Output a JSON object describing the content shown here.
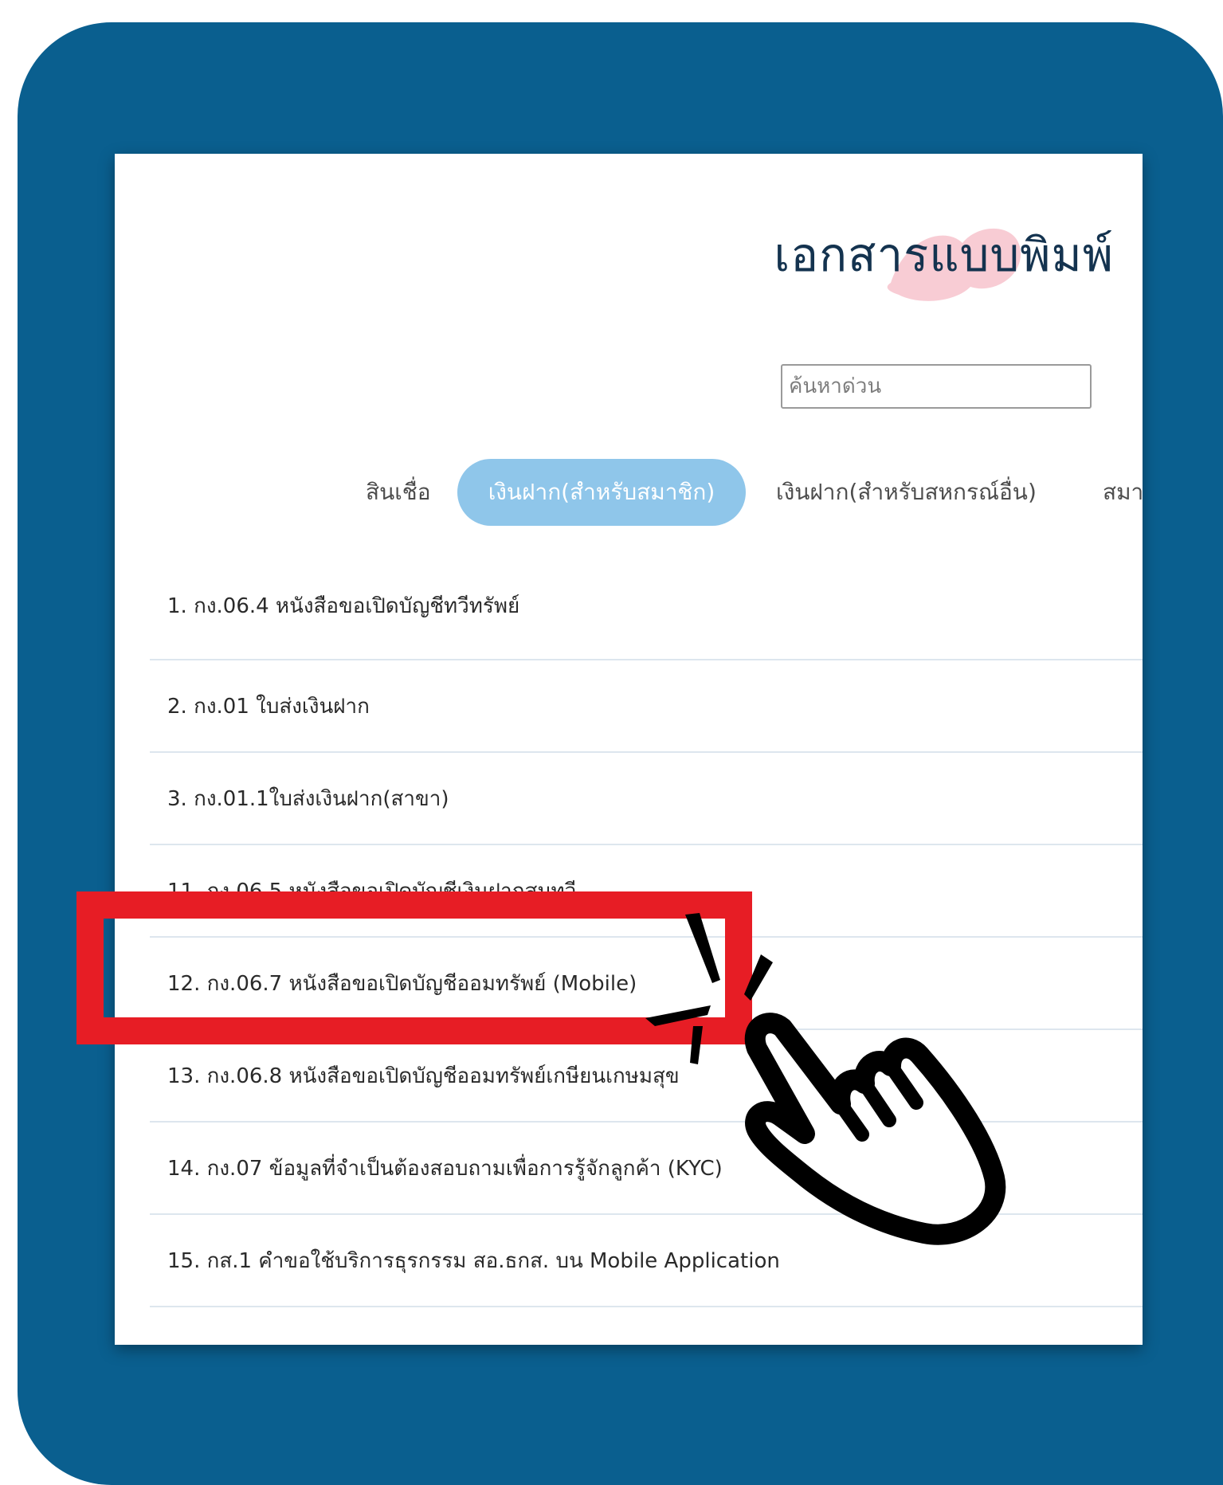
{
  "page": {
    "title": "เอกสารแบบพิมพ์"
  },
  "search": {
    "placeholder": "ค้นหาด่วน",
    "value": ""
  },
  "tabs": [
    {
      "label": "สินเชื่อ",
      "active": false
    },
    {
      "label": "เงินฝาก(สำหรับสมาชิก)",
      "active": true
    },
    {
      "label": "เงินฝาก(สำหรับสหกรณ์อื่น)",
      "active": false
    },
    {
      "label": "สมา",
      "active": false
    }
  ],
  "documents": [
    "1. กง.06.4 หนังสือขอเปิดบัญชีทวีทรัพย์",
    "2. กง.01 ใบส่งเงินฝาก",
    "3. กง.01.1ใบส่งเงินฝาก(สาขา)",
    "11. กง.06.5 หนังสือขอเปิดบัญชีเงินฝากสมทวี",
    "12. กง.06.7 หนังสือขอเปิดบัญชีออมทรัพย์ (Mobile)",
    "13. กง.06.8 หนังสือขอเปิดบัญชีออมทรัพย์เกษียนเกษมสุข",
    "14. กง.07 ข้อมูลที่จำเป็นต้องสอบถามเพื่อการรู้จักลูกค้า (KYC)",
    "15. กส.1 คำขอใช้บริการธุรกรรม สอ.ธกส. บน Mobile Application"
  ],
  "colors": {
    "frame": "#0a5f8f",
    "active_tab": "#8fc6ea",
    "highlight": "#e71d25",
    "heading": "#14334f"
  },
  "icons": {
    "pointer": "hand-pointer-icon"
  }
}
